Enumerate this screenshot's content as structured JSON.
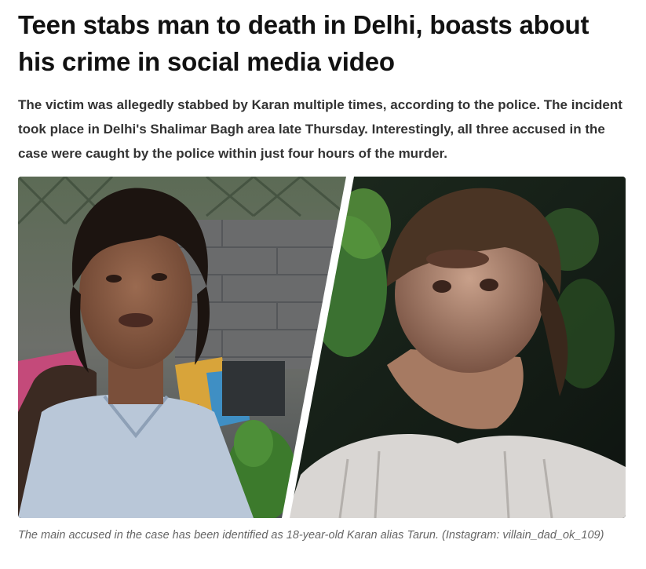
{
  "article": {
    "headline": "Teen stabs man to death in Delhi, boasts about his crime in social media video",
    "summary": "The victim was allegedly stabbed by Karan multiple times, according to the police. The incident took place in Delhi's Shalimar Bagh area late Thursday. Interestingly, all three accused in the case were caught by the police within just four hours of the murder.",
    "image": {
      "caption": "The main accused in the case has been identified as 18-year-old Karan alias Tarun. (Instagram: villain_dad_ok_109)"
    }
  }
}
